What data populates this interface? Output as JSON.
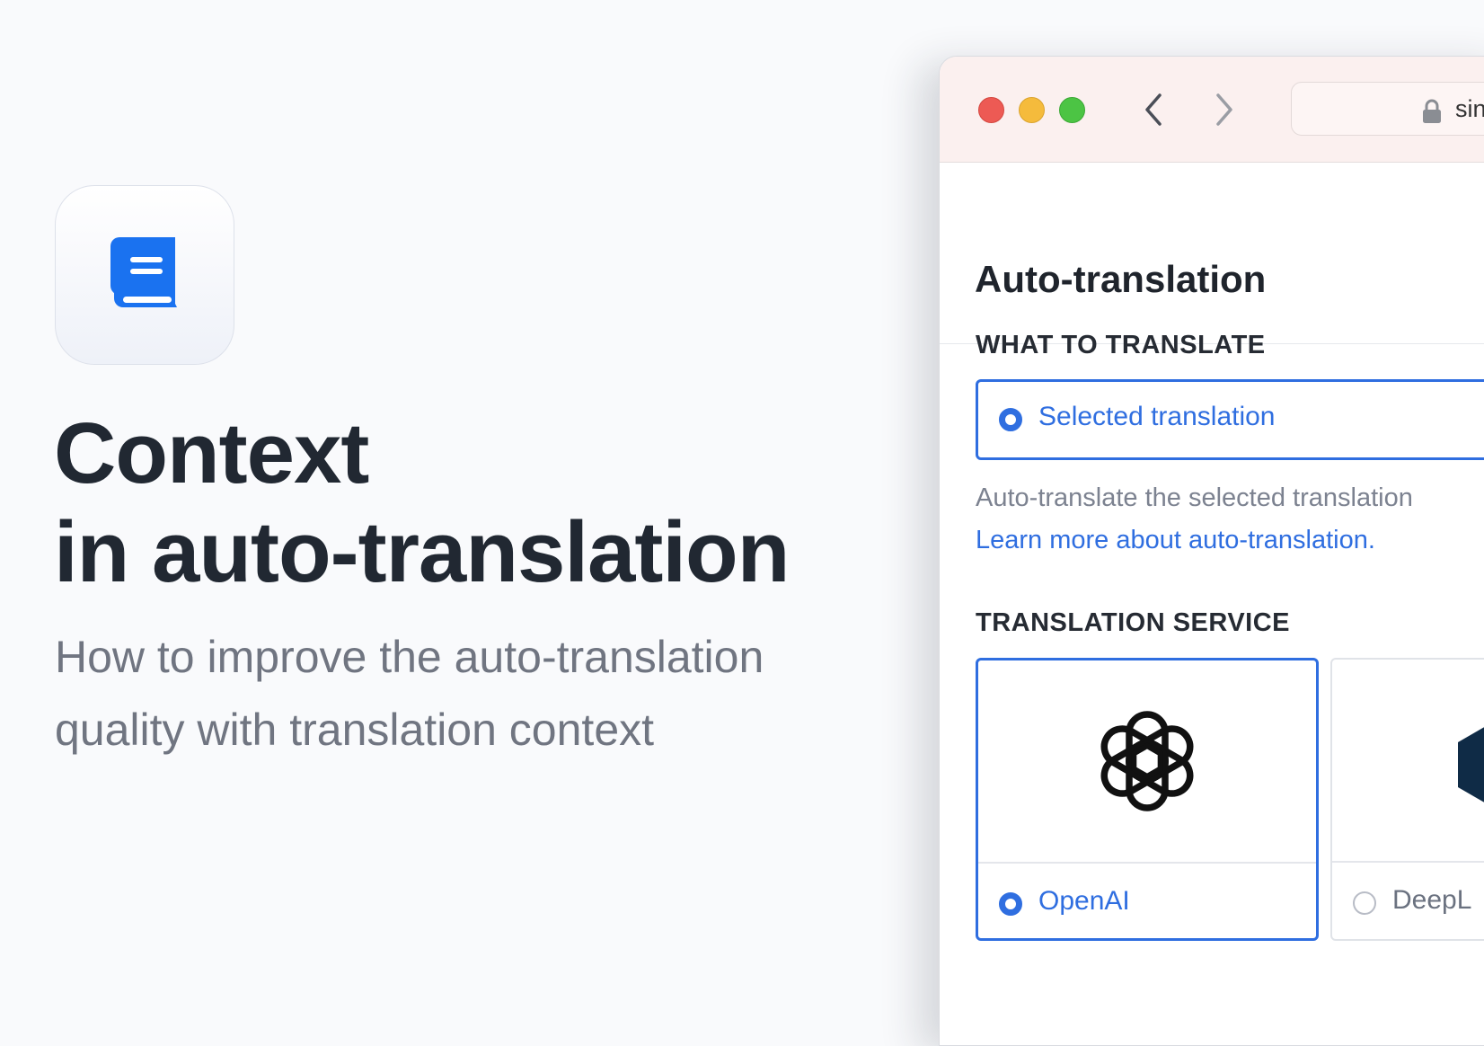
{
  "hero": {
    "title_line1": "Context",
    "title_line2": "in auto-translation",
    "subtitle_line1": "How to improve the auto-translation",
    "subtitle_line2": "quality with translation context",
    "app_icon": "book-icon"
  },
  "browser": {
    "address_text": "sin",
    "nav": {
      "back_icon": "chevron-left-icon",
      "forward_icon": "chevron-right-icon"
    }
  },
  "panel": {
    "title": "Auto-translation",
    "what_to_translate": {
      "label": "WHAT TO TRANSLATE",
      "selected_option": "Selected translation",
      "help_text": "Auto-translate the selected translation",
      "learn_more": "Learn more about auto-translation."
    },
    "translation_service": {
      "label": "TRANSLATION SERVICE",
      "options": [
        {
          "name": "OpenAI",
          "selected": true,
          "logo": "openai-logo"
        },
        {
          "name": "DeepL",
          "selected": false,
          "logo": "deepl-logo"
        }
      ]
    }
  },
  "colors": {
    "accent": "#2f6ee0",
    "brand_icon": "#1a72f0",
    "title_text": "#212832",
    "subtitle_text": "#707581",
    "titlebar": "#fbf0ef",
    "traffic_red": "#ed5a54",
    "traffic_yellow": "#f5bb3c",
    "traffic_green": "#4cc444"
  }
}
